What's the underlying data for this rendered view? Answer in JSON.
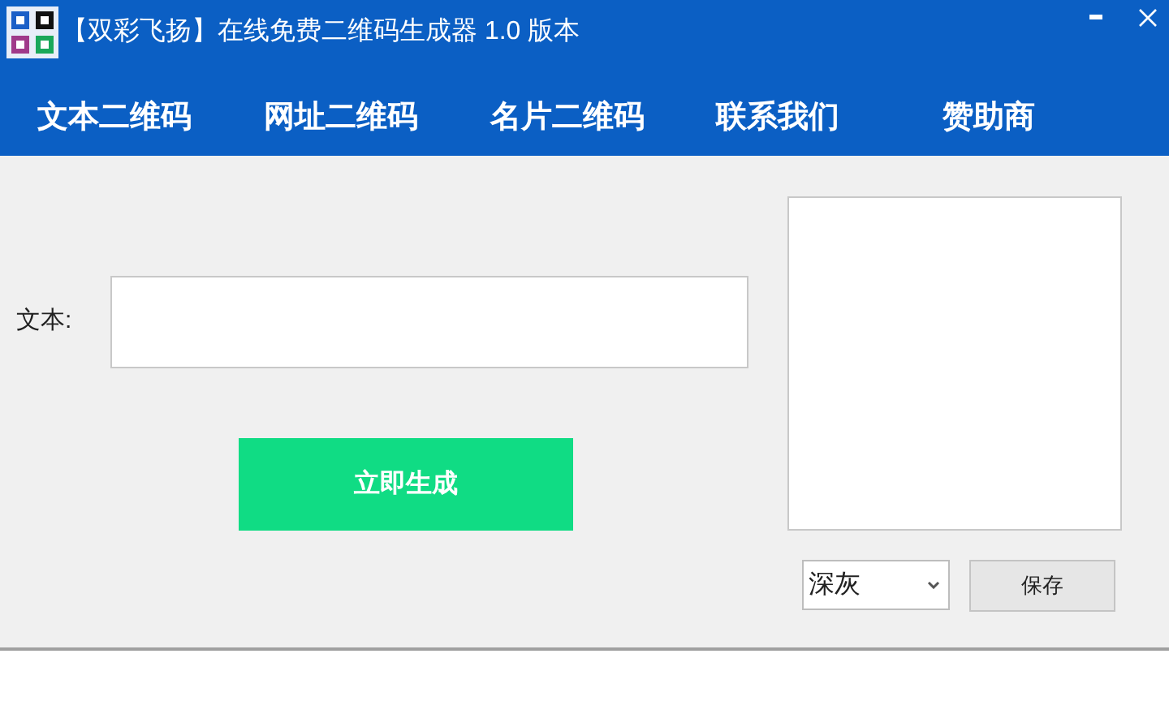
{
  "window": {
    "title": "【双彩飞扬】在线免费二维码生成器 1.0 版本"
  },
  "nav": [
    {
      "label": "文本二维码"
    },
    {
      "label": "网址二维码"
    },
    {
      "label": "名片二维码"
    },
    {
      "label": "联系我们"
    },
    {
      "label": "赞助商"
    }
  ],
  "form": {
    "label": "文本:",
    "generate_button": "立即生成"
  },
  "color_select": {
    "value": "深灰"
  },
  "save_button": "保存"
}
